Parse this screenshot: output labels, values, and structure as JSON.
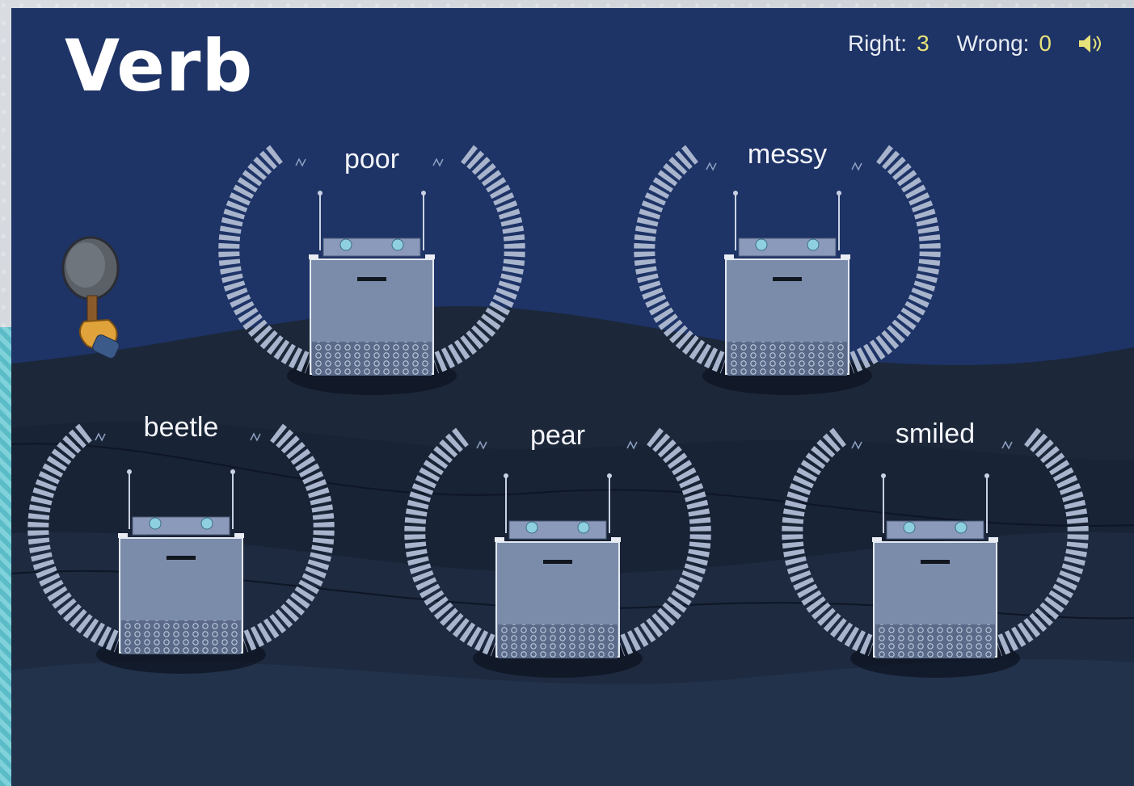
{
  "game": {
    "title": "Verb",
    "score": {
      "right_label": "Right:",
      "right_value": "3",
      "wrong_label": "Wrong:",
      "wrong_value": "0"
    },
    "robots": [
      {
        "word": "poor"
      },
      {
        "word": "messy"
      },
      {
        "word": "beetle"
      },
      {
        "word": "pear"
      },
      {
        "word": "smiled"
      }
    ]
  },
  "colors": {
    "sky": "#1e3366",
    "ground": "#1b2538",
    "robot_body": "#7b8cab",
    "score_value": "#e7e27a",
    "eye": "#8fd0e0"
  },
  "icons": {
    "sound": "speaker-icon",
    "cursor": "hammer-icon"
  }
}
